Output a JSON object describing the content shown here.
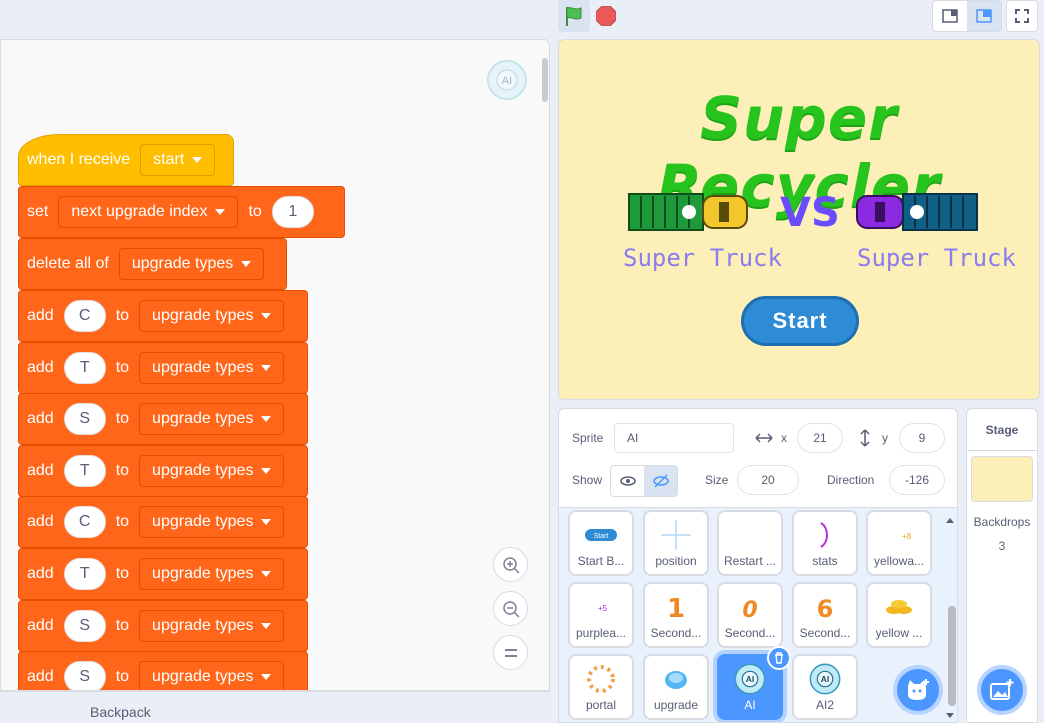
{
  "script": {
    "hat": {
      "label": "when I receive",
      "message": "start"
    },
    "set_block": {
      "label": "set",
      "variable": "next upgrade index",
      "to_label": "to",
      "value": "1"
    },
    "delete_block": {
      "label": "delete all of",
      "list": "upgrade types"
    },
    "add_blocks": [
      {
        "label": "add",
        "item": "C",
        "to_label": "to",
        "list": "upgrade types"
      },
      {
        "label": "add",
        "item": "T",
        "to_label": "to",
        "list": "upgrade types"
      },
      {
        "label": "add",
        "item": "S",
        "to_label": "to",
        "list": "upgrade types"
      },
      {
        "label": "add",
        "item": "T",
        "to_label": "to",
        "list": "upgrade types"
      },
      {
        "label": "add",
        "item": "C",
        "to_label": "to",
        "list": "upgrade types"
      },
      {
        "label": "add",
        "item": "T",
        "to_label": "to",
        "list": "upgrade types"
      },
      {
        "label": "add",
        "item": "S",
        "to_label": "to",
        "list": "upgrade types"
      },
      {
        "label": "add",
        "item": "S",
        "to_label": "to",
        "list": "upgrade types"
      }
    ],
    "zoom_icons": [
      "zoom-in-icon",
      "zoom-out-icon",
      "zoom-reset-icon"
    ]
  },
  "backpack": {
    "label": "Backpack"
  },
  "stage": {
    "title": "Super Recycler",
    "vs": "VS",
    "left_label": "Super Truck",
    "right_label": "Super Truck",
    "start_button": "Start",
    "colors": {
      "background": "#fcefb8",
      "title": "#27c41d",
      "button": "#2e8bd6"
    }
  },
  "sprite_info": {
    "sprite_label": "Sprite",
    "sprite_name": "AI",
    "x_label": "x",
    "x_value": "21",
    "y_label": "y",
    "y_value": "9",
    "show_label": "Show",
    "size_label": "Size",
    "size_value": "20",
    "direction_label": "Direction",
    "direction_value": "-126"
  },
  "sprites": [
    {
      "name": "Start B...",
      "icon": "start-button-icon"
    },
    {
      "name": "position",
      "icon": "crosshair-icon"
    },
    {
      "name": "Restart ...",
      "icon": "blank-icon"
    },
    {
      "name": "stats",
      "icon": "arc-icon"
    },
    {
      "name": "yellowa...",
      "icon": "plus-eight-icon"
    },
    {
      "name": "purplea...",
      "icon": "plus-five-icon"
    },
    {
      "name": "Second...",
      "icon": "digit-one-icon"
    },
    {
      "name": "Second...",
      "icon": "digit-zero-icon"
    },
    {
      "name": "Second...",
      "icon": "digit-six-icon"
    },
    {
      "name": "yellow ...",
      "icon": "coins-icon"
    },
    {
      "name": "portal",
      "icon": "portal-icon"
    },
    {
      "name": "upgrade",
      "icon": "upgrade-icon"
    },
    {
      "name": "AI",
      "icon": "brain-icon",
      "selected": true
    },
    {
      "name": "AI2",
      "icon": "brain-icon"
    }
  ],
  "stage_panel": {
    "title": "Stage",
    "backdrops_label": "Backdrops",
    "backdrops_count": "3"
  },
  "accent": "#4c97ff",
  "block_color": "#ff661a",
  "event_color": "#ffbf00"
}
